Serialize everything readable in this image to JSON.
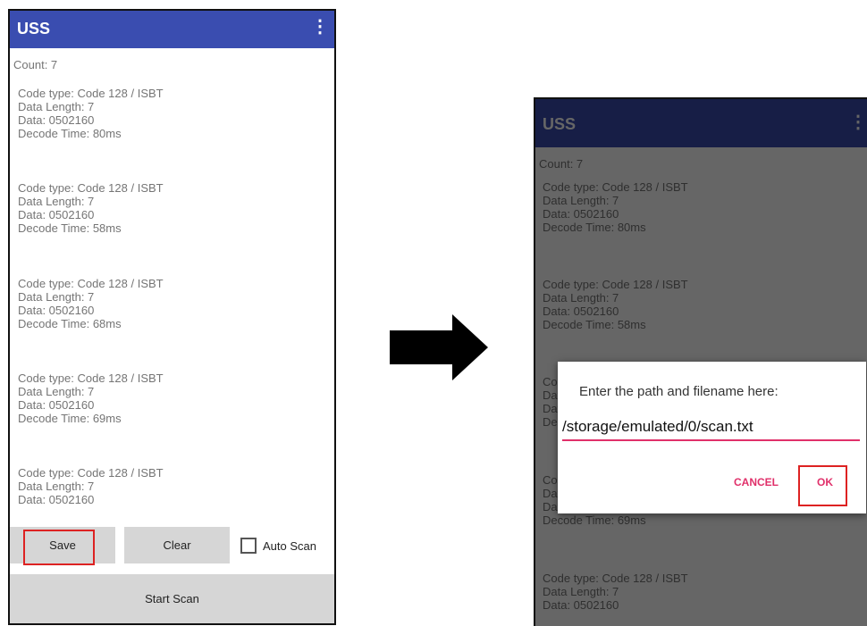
{
  "app_title": "USS",
  "count_label": "Count:  7",
  "entries": [
    {
      "code_type": "Code type: Code 128 / ISBT",
      "data_length": "Data Length: 7",
      "data": "Data: 0502160",
      "decode_time": "Decode Time: 80ms"
    },
    {
      "code_type": "Code type: Code 128 / ISBT",
      "data_length": "Data Length: 7",
      "data": "Data: 0502160",
      "decode_time": "Decode Time: 58ms"
    },
    {
      "code_type": "Code type: Code 128 / ISBT",
      "data_length": "Data Length: 7",
      "data": "Data: 0502160",
      "decode_time": "Decode Time: 68ms"
    },
    {
      "code_type": "Code type: Code 128 / ISBT",
      "data_length": "Data Length: 7",
      "data": "Data: 0502160",
      "decode_time": "Decode Time: 69ms"
    },
    {
      "code_type": "Code type: Code 128 / ISBT",
      "data_length": "Data Length: 7",
      "data": "Data: 0502160"
    }
  ],
  "buttons": {
    "save": "Save",
    "clear": "Clear",
    "auto_scan": "Auto Scan",
    "start_scan": "Start Scan"
  },
  "dialog": {
    "message": "Enter the path and filename here:",
    "path_value": "/storage/emulated/0/scan.txt",
    "cancel": "CANCEL",
    "ok": "OK"
  },
  "colors": {
    "app_bar": "#3a4db0",
    "accent": "#e0306a",
    "highlight": "#dd2222"
  },
  "icons": [
    "overflow-menu-icon",
    "checkbox-icon",
    "right-arrow-icon"
  ]
}
